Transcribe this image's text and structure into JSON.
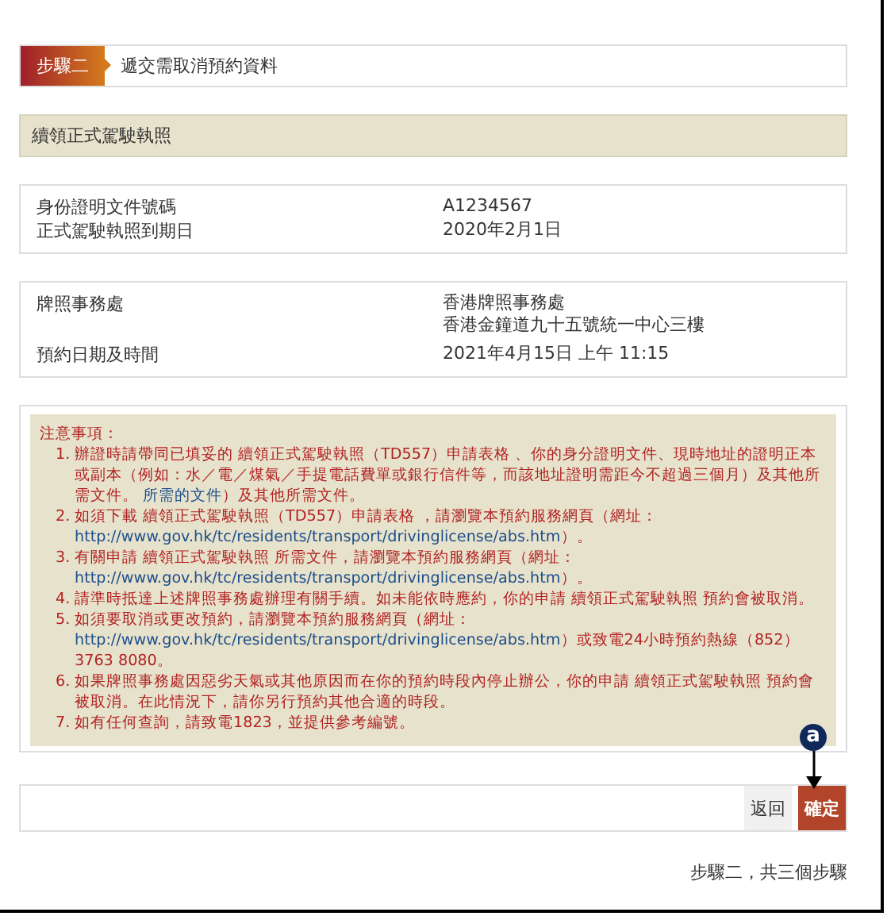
{
  "step": {
    "badge": "步驟二",
    "title": "遞交需取消預約資料"
  },
  "service": "續領正式駕駛執照",
  "identity": [
    {
      "label": "身份證明文件號碼",
      "value": "A1234567"
    },
    {
      "label": "正式駕駛執照到期日",
      "value": "2020年2月1日"
    }
  ],
  "appointment": [
    {
      "label": "牌照事務處",
      "values": [
        "香港牌照事務處",
        "香港金鐘道九十五號統一中心三樓"
      ]
    },
    {
      "label": "預約日期及時間",
      "values": [
        "2021年4月15日 上午 11:15"
      ]
    }
  ],
  "notes": {
    "heading": "注意事項：",
    "items": [
      {
        "number": "1.",
        "parts": [
          {
            "text": "辦證時請帶同已填妥的 續領正式駕駛執照（TD557）申請表格 、你的身分證明文件、現時地址的證明正本或副本（例如：水／電／煤氣／手提電話費單或銀行信件等，而該地址證明需距今不超過三個月）及其他所需文件。 ",
            "kind": "text"
          },
          {
            "text": "所需的文件",
            "kind": "link"
          },
          {
            "text": "）及其他所需文件。",
            "kind": "text"
          }
        ]
      },
      {
        "number": "2.",
        "parts": [
          {
            "text": "如須下載 續領正式駕駛執照（TD557）申請表格 ，請瀏覽本預約服務網頁（網址：",
            "kind": "text"
          },
          {
            "text": "http://www.gov.hk/tc/residents/transport/drivinglicense/abs.htm",
            "kind": "link"
          },
          {
            "text": "）。",
            "kind": "text"
          }
        ]
      },
      {
        "number": "3.",
        "parts": [
          {
            "text": "有關申請 續領正式駕駛執照 所需文件，請瀏覽本預約服務網頁（網址：",
            "kind": "text"
          },
          {
            "text": "http://www.gov.hk/tc/residents/transport/drivinglicense/abs.htm",
            "kind": "link"
          },
          {
            "text": "）。",
            "kind": "text"
          }
        ]
      },
      {
        "number": "4.",
        "parts": [
          {
            "text": "請準時抵達上述牌照事務處辦理有關手續。如未能依時應約，你的申請 續領正式駕駛執照 預約會被取消。",
            "kind": "text"
          }
        ]
      },
      {
        "number": "5.",
        "parts": [
          {
            "text": "如須要取消或更改預約，請瀏覽本預約服務網頁（網址： ",
            "kind": "text"
          },
          {
            "text": "http://www.gov.hk/tc/residents/transport/drivinglicense/abs.htm",
            "kind": "link"
          },
          {
            "text": "）或致電24小時預約熱線（852） 3763 8080。",
            "kind": "text"
          }
        ]
      },
      {
        "number": "6.",
        "parts": [
          {
            "text": "如果牌照事務處因惡劣天氣或其他原因而在你的預約時段內停止辦公，你的申請 續領正式駕駛執照 預約會被取消。在此情況下，請你另行預約其他合適的時段。",
            "kind": "text"
          }
        ]
      },
      {
        "number": "7.",
        "parts": [
          {
            "text": "如有任何查詢，請致電1823，並提供參考編號。",
            "kind": "text"
          }
        ]
      }
    ]
  },
  "callout": "a",
  "buttons": [
    {
      "label": "返回",
      "kind": "secondary"
    },
    {
      "label": "確定",
      "kind": "primary"
    }
  ],
  "footer": "步驟二，共三個步驟"
}
